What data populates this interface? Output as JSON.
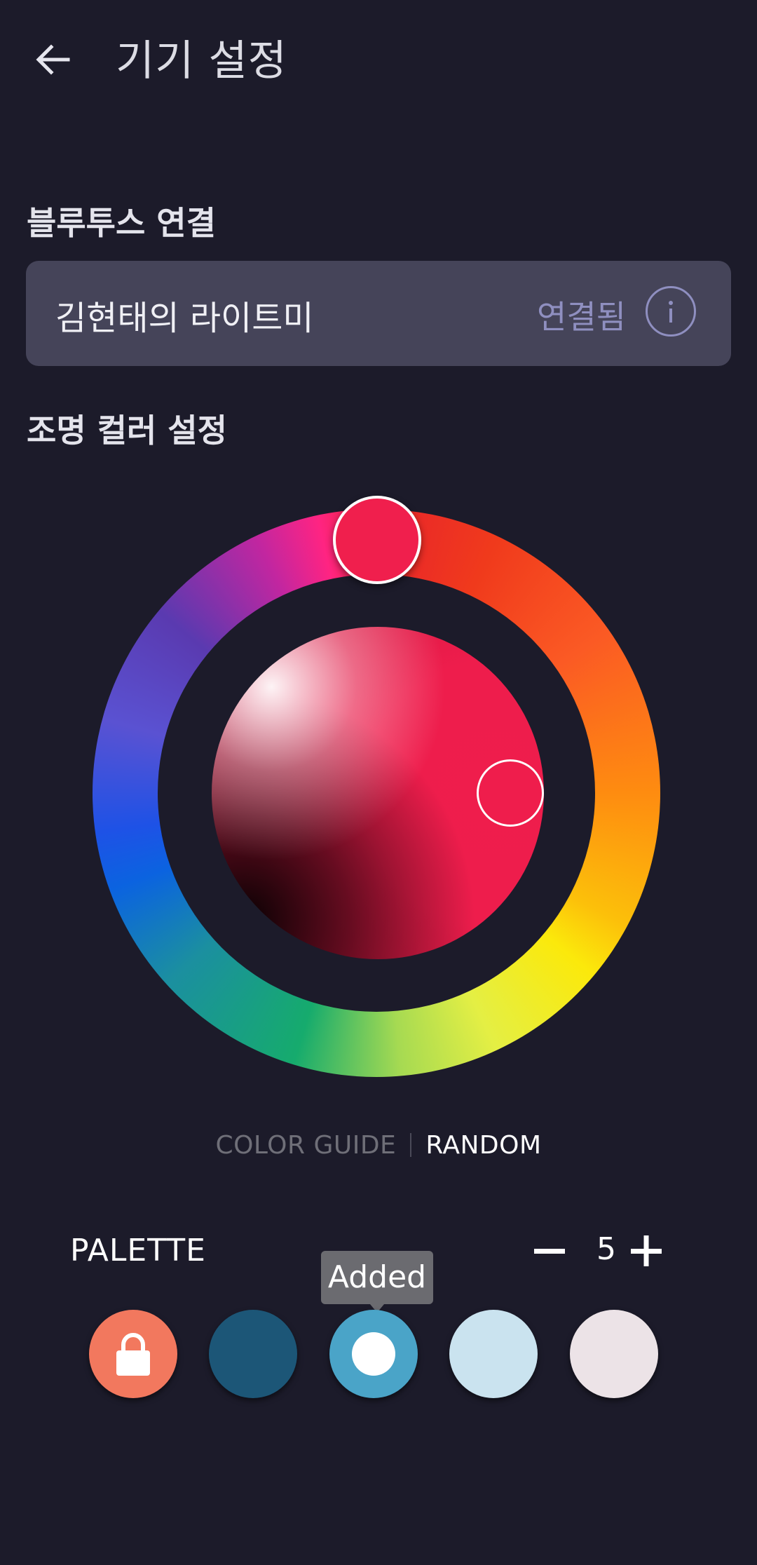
{
  "header": {
    "title": "기기 설정",
    "back_icon": "arrow-left-icon"
  },
  "bluetooth": {
    "section_title": "블루투스 연결",
    "device_name": "김현태의 라이트미",
    "status": "연결됨",
    "info_icon": "info-icon"
  },
  "color_settings": {
    "section_title": "조명 컬러 설정",
    "selected_hue_color": "#f01f4d",
    "selected_color": "#ef1d4c"
  },
  "modes": {
    "guide_label": "COLOR GUIDE",
    "random_label": "RANDOM",
    "active": "RANDOM"
  },
  "palette": {
    "label": "PALETTE",
    "count": "5",
    "minus_icon": "minus-icon",
    "plus_icon": "plus-icon",
    "tooltip": "Added",
    "swatches": [
      {
        "color": "#f2785e",
        "icon": "lock-icon",
        "locked": true
      },
      {
        "color": "#1c5677",
        "icon": "",
        "locked": false
      },
      {
        "color": "#4aa4c8",
        "icon": "selected-dot",
        "locked": false
      },
      {
        "color": "#cae3ef",
        "icon": "",
        "locked": false
      },
      {
        "color": "#ece3e7",
        "icon": "",
        "locked": false
      }
    ]
  }
}
